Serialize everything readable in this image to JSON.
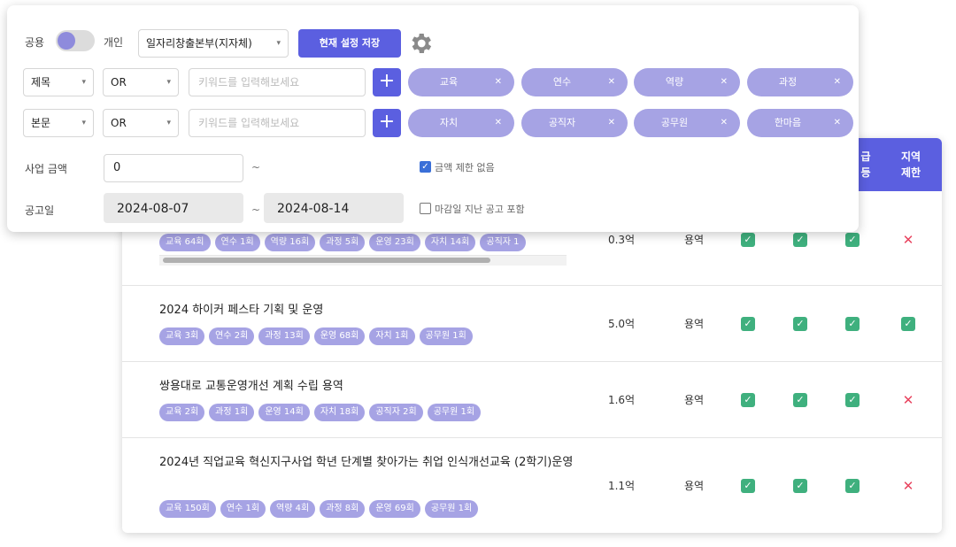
{
  "filter": {
    "scope_left": "공용",
    "scope_right": "개인",
    "preset_select": "일자리창출본부(지자체)",
    "save_label": "현재 설정 저장",
    "rows": [
      {
        "field": "제목",
        "operator": "OR",
        "placeholder": "키워드를 입력해보세요",
        "keywords": [
          "교육",
          "연수",
          "역량",
          "과정"
        ]
      },
      {
        "field": "본문",
        "operator": "OR",
        "placeholder": "키워드를 입력해보세요",
        "keywords": [
          "자치",
          "공직자",
          "공무원",
          "한마음"
        ]
      }
    ],
    "amount_label": "사업 금액",
    "amount_min": "0",
    "amount_sep": "~",
    "no_limit_label": "금액 제한 없음",
    "no_limit_checked": true,
    "date_label": "공고일",
    "date_from": "2024-08-07",
    "date_sep": "~",
    "date_to": "2024-08-14",
    "include_expired_label": "마감일 지난 공고 포함",
    "include_expired_checked": false
  },
  "table": {
    "headers": {
      "partial_top": "급",
      "partial_bottom": "등",
      "region_line1": "지역",
      "region_line2": "제한"
    },
    "rows": [
      {
        "title": "",
        "chips": [
          "교육 64회",
          "연수 1회",
          "역량 16회",
          "과정 5회",
          "운영 23회",
          "자치 14회",
          "공직자 1"
        ],
        "amount": "0.3억",
        "type": "용역",
        "checks": [
          true,
          true,
          true,
          false
        ]
      },
      {
        "title": "2024 하이커 페스타 기획 및 운영",
        "chips": [
          "교육 3회",
          "연수 2회",
          "과정 13회",
          "운영 68회",
          "자치 1회",
          "공무원 1회"
        ],
        "amount": "5.0억",
        "type": "용역",
        "checks": [
          true,
          true,
          true,
          true
        ]
      },
      {
        "title": "쌍용대로 교통운영개선 계획 수립 용역",
        "chips": [
          "교육 2회",
          "과정 1회",
          "운영 14회",
          "자치 18회",
          "공직자 2회",
          "공무원 1회"
        ],
        "amount": "1.6억",
        "type": "용역",
        "checks": [
          true,
          true,
          true,
          false
        ]
      },
      {
        "title": "2024년 직업교육 혁신지구사업 학년 단계별 찾아가는 취업 인식개선교육 (2학기)운영",
        "chips": [
          "교육 150회",
          "연수 1회",
          "역량 4회",
          "과정 8회",
          "운영 69회",
          "공무원 1회"
        ],
        "amount": "1.1억",
        "type": "용역",
        "checks": [
          true,
          true,
          true,
          false
        ]
      }
    ]
  },
  "colors": {
    "accent": "#5b5fe0",
    "chip": "#a6a3e4",
    "check": "#3fb07e",
    "cross": "#e8435e"
  }
}
